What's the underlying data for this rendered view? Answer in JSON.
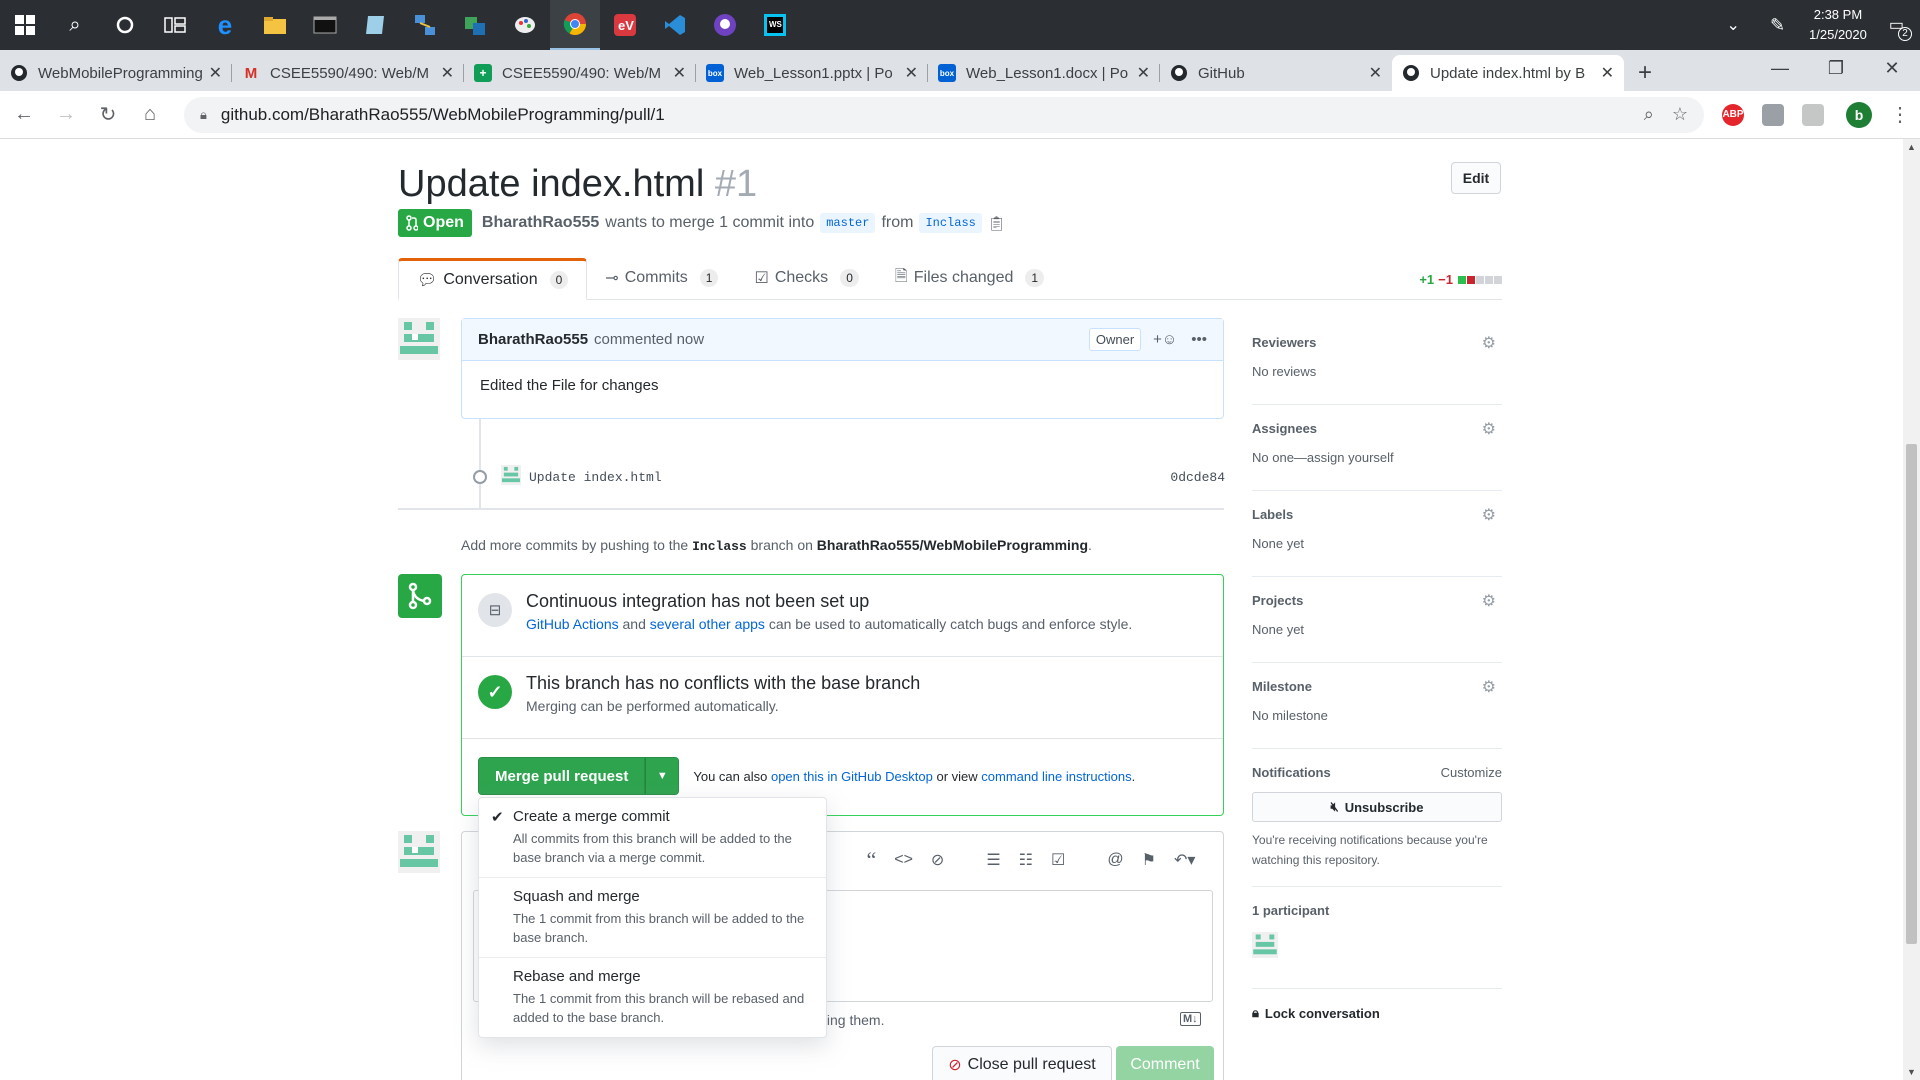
{
  "taskbar": {
    "apps": [
      "windows-start",
      "search",
      "cortana",
      "task-view",
      "edge",
      "file-explorer",
      "terminal",
      "notepad",
      "network-app",
      "remote-app",
      "paint",
      "chrome",
      "expressvpn",
      "vscode",
      "github-desktop",
      "webstorm"
    ],
    "time": "2:38 PM",
    "date": "1/25/2020",
    "notifications": "2"
  },
  "browser": {
    "tabs": [
      {
        "label": "WebMobileProgramming",
        "icon": "github-icon"
      },
      {
        "label": "CSEE5590/490: Web/M",
        "icon": "gmail-icon"
      },
      {
        "label": "CSEE5590/490: Web/M",
        "icon": "sheets-icon"
      },
      {
        "label": "Web_Lesson1.pptx | Po",
        "icon": "box-icon"
      },
      {
        "label": "Web_Lesson1.docx | Po",
        "icon": "box-icon"
      },
      {
        "label": "GitHub",
        "icon": "github-icon"
      },
      {
        "label": "Update index.html by B",
        "icon": "github-icon"
      }
    ],
    "url": "github.com/BharathRao555/WebMobileProgramming/pull/1",
    "profile_initial": "b",
    "ext_abp": "ABP"
  },
  "pr": {
    "title": "Update index.html",
    "number": "#1",
    "edit_label": "Edit",
    "state": "Open",
    "author": "BharathRao555",
    "merge_text": "wants to merge 1 commit into",
    "base_branch": "master",
    "from_text": "from",
    "head_branch": "Inclass"
  },
  "tabs": [
    {
      "label": "Conversation",
      "count": "0"
    },
    {
      "label": "Commits",
      "count": "1"
    },
    {
      "label": "Checks",
      "count": "0"
    },
    {
      "label": "Files changed",
      "count": "1"
    }
  ],
  "diffstat": {
    "add": "+1",
    "del": "−1"
  },
  "comment": {
    "author": "BharathRao555",
    "action": "commented now",
    "role": "Owner",
    "body": "Edited the File for changes"
  },
  "commit": {
    "message": "Update index.html",
    "sha": "0dcde84"
  },
  "push_note": {
    "prefix": "Add more commits by pushing to the",
    "branch": "Inclass",
    "middle": "branch on",
    "repo": "BharathRao555/WebMobileProgramming",
    "suffix": "."
  },
  "merge": {
    "ci_title": "Continuous integration has not been set up",
    "ci_link1": "GitHub Actions",
    "ci_and": "and",
    "ci_link2": "several other apps",
    "ci_rest": "can be used to automatically catch bugs and enforce style.",
    "ok_title": "This branch has no conflicts with the base branch",
    "ok_sub": "Merging can be performed automatically.",
    "button": "Merge pull request",
    "alt_prefix": "You can also",
    "alt_link1": "open this in GitHub Desktop",
    "alt_mid": "or view",
    "alt_link2": "command line instructions",
    "alt_suffix": "."
  },
  "merge_options": [
    {
      "title": "Create a merge commit",
      "desc": "All commits from this branch will be added to the base branch via a merge commit.",
      "checked": true
    },
    {
      "title": "Squash and merge",
      "desc": "The 1 commit from this branch will be added to the base branch.",
      "checked": false
    },
    {
      "title": "Rebase and merge",
      "desc": "The 1 commit from this branch will be rebased and added to the base branch.",
      "checked": false
    }
  ],
  "editor": {
    "hint": "ting them.",
    "close_label": "Close pull request",
    "comment_label": "Comment"
  },
  "sidebar": {
    "reviewers": {
      "label": "Reviewers",
      "value": "No reviews"
    },
    "assignees": {
      "label": "Assignees",
      "value": "No one—assign yourself"
    },
    "labels": {
      "label": "Labels",
      "value": "None yet"
    },
    "projects": {
      "label": "Projects",
      "value": "None yet"
    },
    "milestone": {
      "label": "Milestone",
      "value": "No milestone"
    },
    "notifications": {
      "label": "Notifications",
      "customize": "Customize",
      "button": "Unsubscribe",
      "note": "You're receiving notifications because you're watching this repository."
    },
    "participants": "1 participant",
    "lock": "Lock conversation"
  },
  "colors": {
    "green": "#28a745",
    "blue": "#0366d6",
    "red": "#cb2431"
  }
}
